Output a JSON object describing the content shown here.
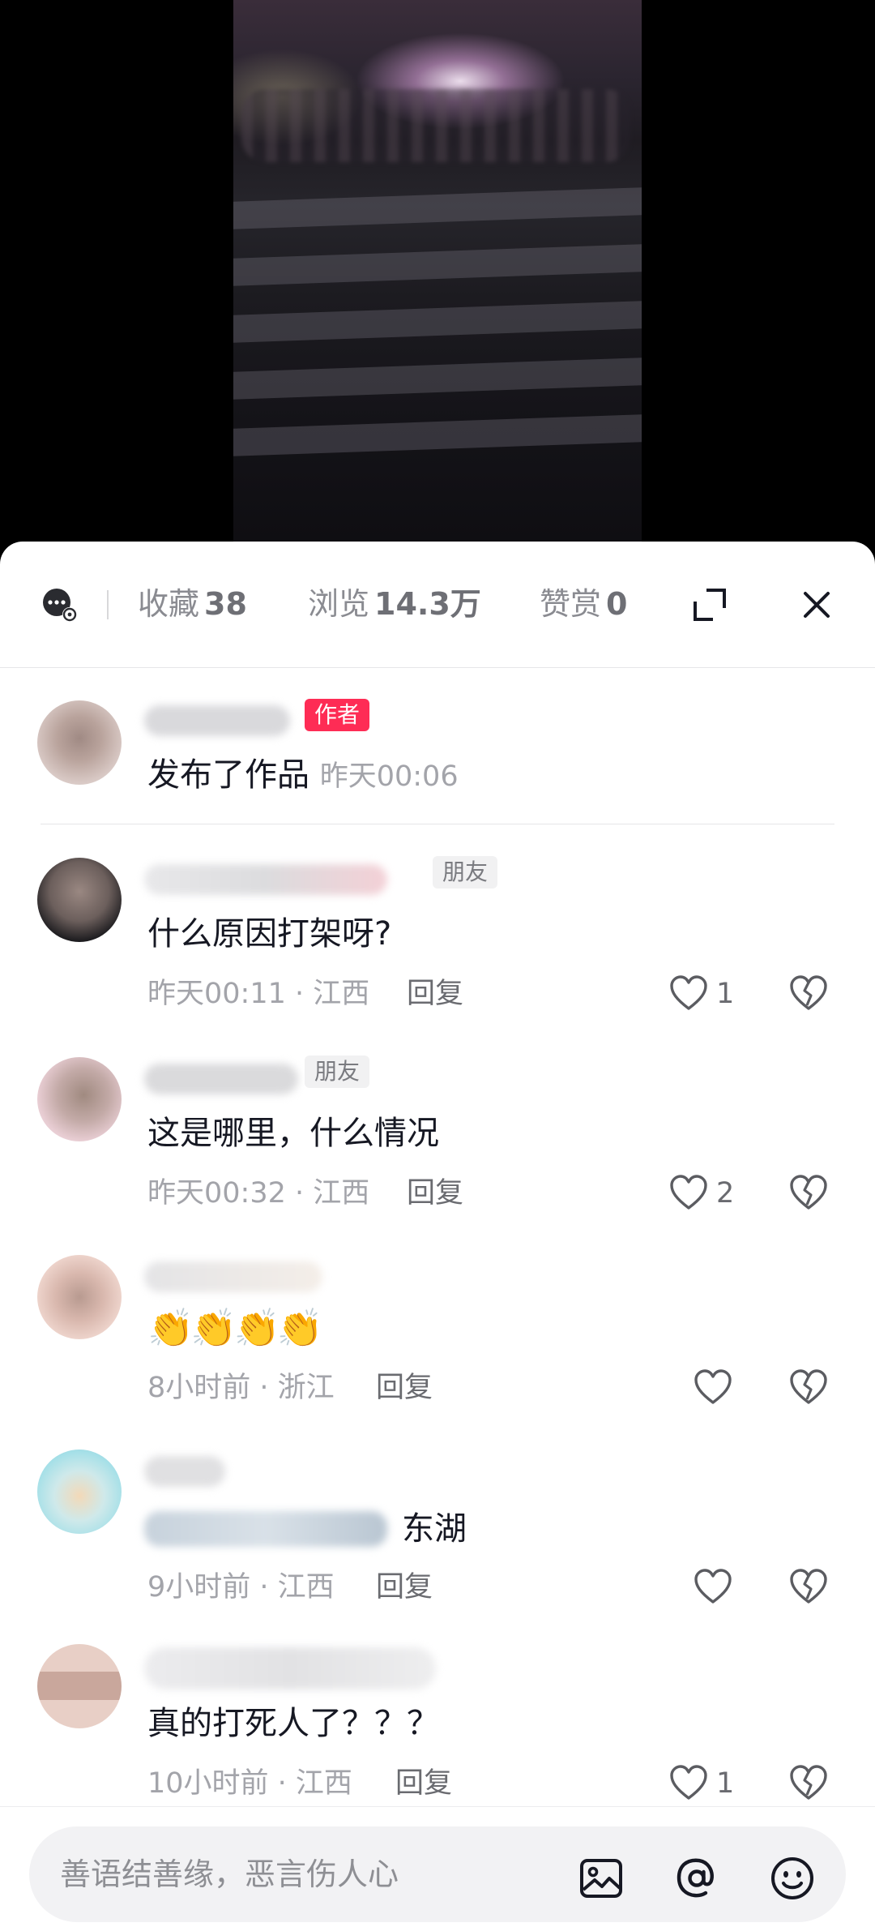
{
  "top_bar": {
    "favorites_label": "收藏",
    "favorites_count": "38",
    "views_label": "浏览",
    "views_count": "14.3万",
    "rewards_label": "赞赏",
    "rewards_count": "0"
  },
  "author_post": {
    "tag": "作者",
    "text": "发布了作品",
    "time": "昨天00:06"
  },
  "comments": [
    {
      "tag": "朋友",
      "text": "什么原因打架呀?",
      "meta": "昨天00:11 · 江西",
      "reply": "回复",
      "likes": "1"
    },
    {
      "tag": "朋友",
      "text": "这是哪里，什么情况",
      "meta": "昨天00:32 · 江西",
      "reply": "回复",
      "likes": "2"
    },
    {
      "text": "👏👏👏👏",
      "meta": "8小时前 · 浙江",
      "reply": "回复",
      "likes": ""
    },
    {
      "text": "东湖",
      "meta": "9小时前 · 江西",
      "reply": "回复",
      "likes": ""
    },
    {
      "text": "真的打死人了？？？",
      "meta": "10小时前 · 江西",
      "reply": "回复",
      "likes": "1"
    }
  ],
  "input": {
    "placeholder": "善语结善缘，恶言伤人心"
  },
  "colors": {
    "accent": "#fe2c55",
    "muted_text": "#a3a4aa"
  }
}
